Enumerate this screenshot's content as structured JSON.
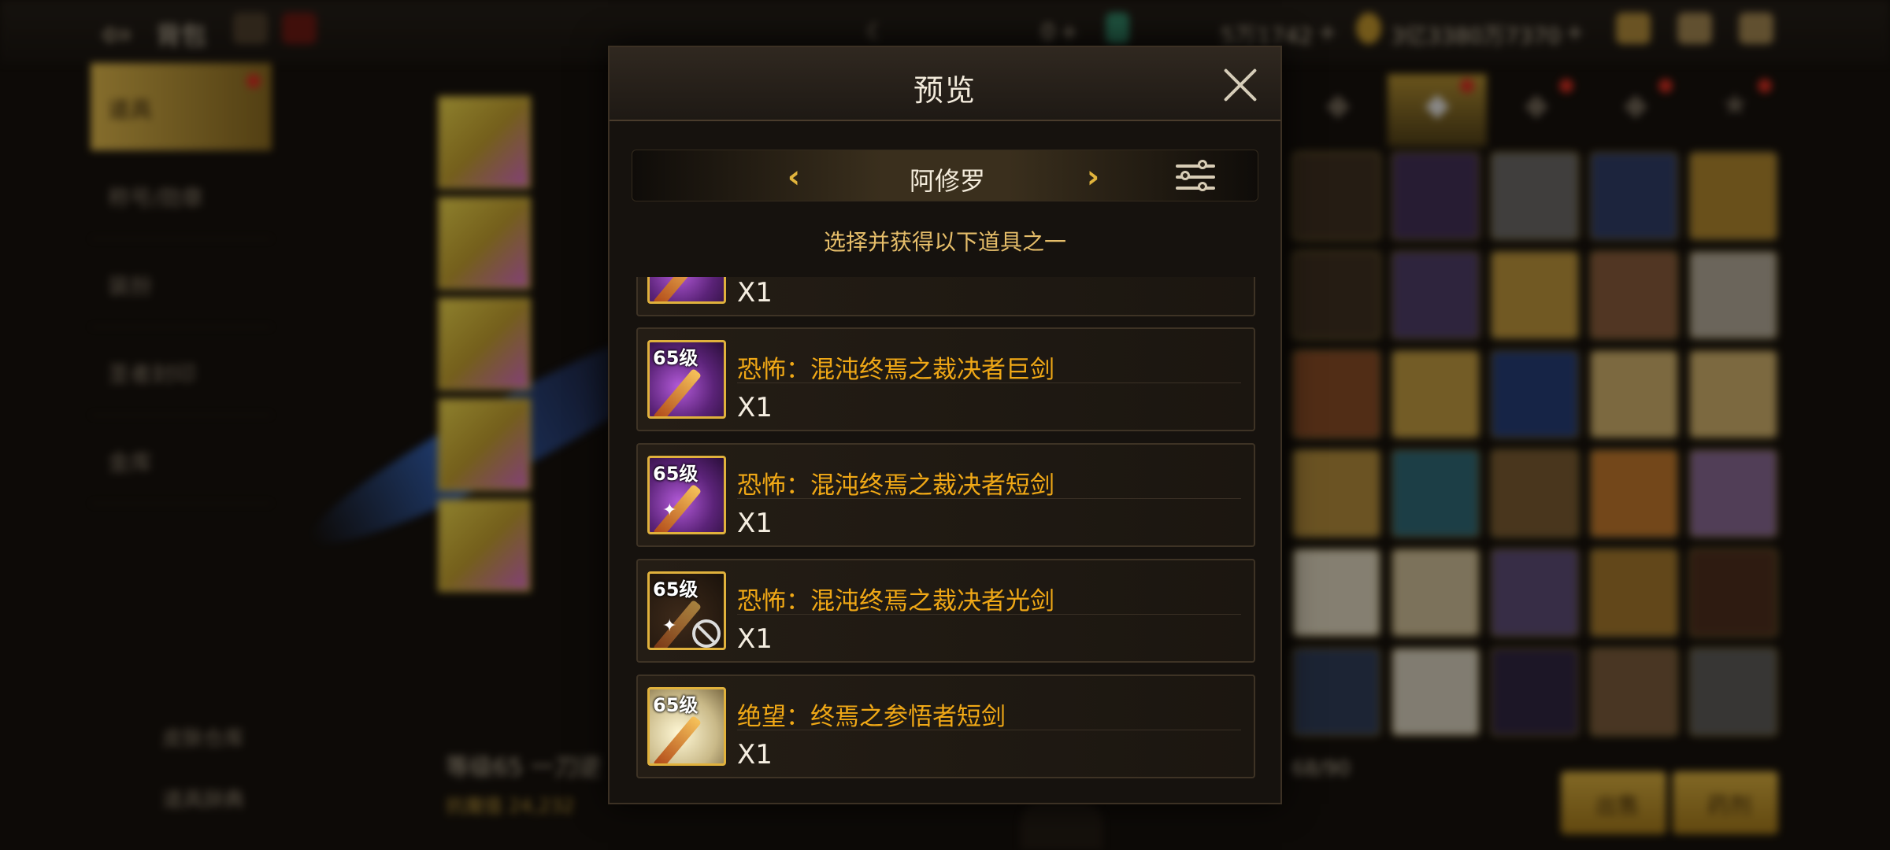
{
  "background": {
    "header_title": "背包",
    "resources": {
      "gem": "0",
      "silver": "5万1742",
      "gold": "3亿3380万7370"
    },
    "sidebar": [
      "道具",
      "称号/勋章",
      "装扮",
      "圣者封印",
      "金库"
    ],
    "sidebar_bottom": [
      "皮肤仓库",
      "道具辞典"
    ],
    "selected_item_name": "等级65 一刀逆",
    "selected_item_stat": "抗魔值 24,232",
    "grid_count": "68/90",
    "buttons": {
      "sell": "出售",
      "potion": "药剂"
    }
  },
  "modal": {
    "title": "预览",
    "class_name": "阿修罗",
    "instruction": "选择并获得以下道具之一",
    "items": [
      {
        "level": "",
        "name": "",
        "qty": "X1",
        "style": "purple"
      },
      {
        "level": "65级",
        "name": "恐怖：混沌终焉之裁决者巨剑",
        "qty": "X1",
        "style": "purple"
      },
      {
        "level": "65级",
        "name": "恐怖：混沌终焉之裁决者短剑",
        "qty": "X1",
        "style": "purple"
      },
      {
        "level": "65级",
        "name": "恐怖：混沌终焉之裁决者光剑",
        "qty": "X1",
        "style": "dark"
      },
      {
        "level": "65级",
        "name": "绝望：终焉之参悟者短剑",
        "qty": "X1",
        "style": "cream"
      }
    ]
  },
  "colors": {
    "accent_gold": "#e0b13c",
    "item_name": "#f0a816",
    "instruction": "#e6be6a",
    "notify_dot": "#e02a1e"
  }
}
